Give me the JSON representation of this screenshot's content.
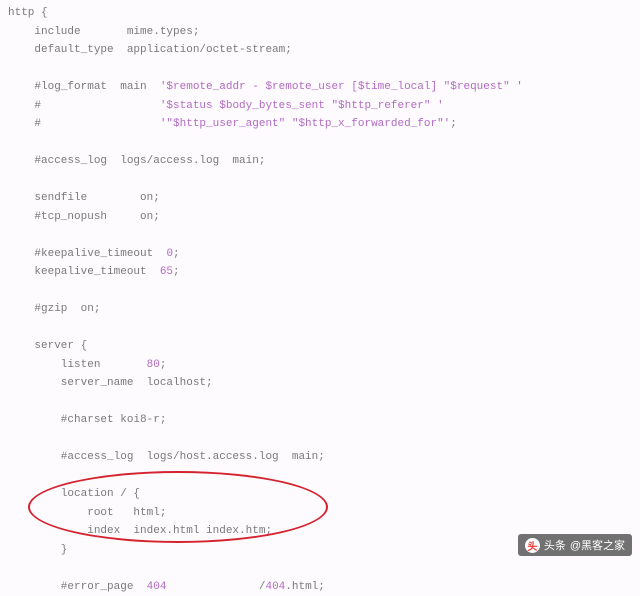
{
  "code": {
    "l01": "http {",
    "l02": "    include       mime.types;",
    "l03": "    default_type  application/octet-stream;",
    "l04": "",
    "l05a": "    #log_format  main  ",
    "l05b": "'$remote_addr - $remote_user [$time_local] \"$request\" '",
    "l06a": "    #                  ",
    "l06b": "'$status $body_bytes_sent \"$http_referer\" '",
    "l07a": "    #                  ",
    "l07b": "'\"$http_user_agent\" \"$http_x_forwarded_for\"'",
    "l07c": ";",
    "l08": "",
    "l09": "    #access_log  logs/access.log  main;",
    "l10": "",
    "l11": "    sendfile        on;",
    "l12": "    #tcp_nopush     on;",
    "l13": "",
    "l14a": "    #keepalive_timeout  ",
    "l14b": "0",
    "l14c": ";",
    "l15a": "    keepalive_timeout  ",
    "l15b": "65",
    "l15c": ";",
    "l16": "",
    "l17": "    #gzip  on;",
    "l18": "",
    "l19": "    server {",
    "l20a": "        listen       ",
    "l20b": "80",
    "l20c": ";",
    "l21": "        server_name  localhost;",
    "l22": "",
    "l23": "        #charset koi8-r;",
    "l24": "",
    "l25": "        #access_log  logs/host.access.log  main;",
    "l26": "",
    "l27": "        location / {",
    "l28": "            root   html;",
    "l29": "            index  index.html index.htm;",
    "l30": "        }",
    "l31": "",
    "l32a": "        #error_page  ",
    "l32b": "404",
    "l32c": "              /",
    "l32d": "404",
    "l32e": ".html;"
  },
  "watermark": {
    "icon_char": "头",
    "prefix": "头条",
    "handle": "@黑客之家"
  }
}
